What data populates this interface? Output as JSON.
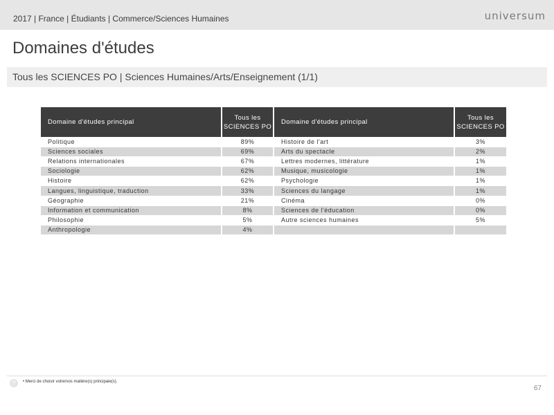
{
  "header": {
    "text": "2017 | France | Étudiants | Commerce/Sciences Humaines",
    "logo": "universum"
  },
  "page_title": "Domaines d'études",
  "subtitle": "Tous les SCIENCES PO | Sciences Humaines/Arts/Enseignement (1/1)",
  "table": {
    "headers": {
      "name_left": "Domaine d'études principal",
      "value_left_line1": "Tous les",
      "value_left_line2": "SCIENCES PO",
      "name_right": "Domaine d'études principal",
      "value_right_line1": "Tous les",
      "value_right_line2": "SCIENCES PO"
    },
    "rows": [
      {
        "left_name": "Politique",
        "left_value": "89%",
        "right_name": "Histoire de l'art",
        "right_value": "3%"
      },
      {
        "left_name": "Sciences sociales",
        "left_value": "69%",
        "right_name": "Arts du spectacle",
        "right_value": "2%"
      },
      {
        "left_name": "Relations internationales",
        "left_value": "67%",
        "right_name": "Lettres modernes, littérature",
        "right_value": "1%"
      },
      {
        "left_name": "Sociologie",
        "left_value": "62%",
        "right_name": "Musique, musicologie",
        "right_value": "1%"
      },
      {
        "left_name": "Histoire",
        "left_value": "62%",
        "right_name": "Psychologie",
        "right_value": "1%"
      },
      {
        "left_name": "Langues, linguistique, traduction",
        "left_value": "33%",
        "right_name": "Sciences du langage",
        "right_value": "1%"
      },
      {
        "left_name": "Géographie",
        "left_value": "21%",
        "right_name": "Cinéma",
        "right_value": "0%"
      },
      {
        "left_name": "Information et communication",
        "left_value": "8%",
        "right_name": "Sciences de l'éducation",
        "right_value": "0%"
      },
      {
        "left_name": "Philosophie",
        "left_value": "5%",
        "right_name": "Autre sciences humaines",
        "right_value": "5%"
      },
      {
        "left_name": "Anthropologie",
        "left_value": "4%",
        "right_name": "",
        "right_value": ""
      }
    ]
  },
  "footer": {
    "help_icon": "question-icon",
    "help_glyph": "?",
    "footnote": "•  Merci de choisir votre/vos matière(s) principale(s).",
    "page_number": "67"
  }
}
